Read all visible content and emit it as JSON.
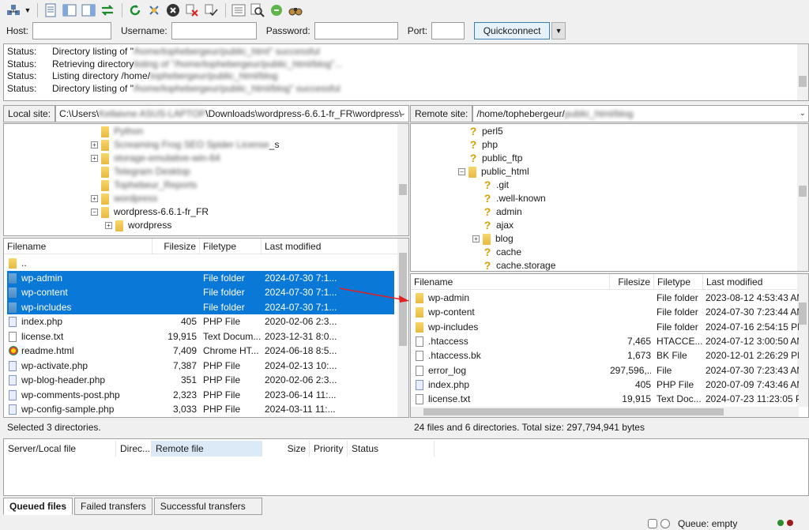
{
  "quickconnect": {
    "host_label": "Host:",
    "username_label": "Username:",
    "password_label": "Password:",
    "port_label": "Port:",
    "button_label": "Quickconnect"
  },
  "log": [
    {
      "key": "Status:",
      "text": "Directory listing of \"",
      "blurred": "/home/tophebergeur/public_html\" successful"
    },
    {
      "key": "Status:",
      "text": "Retrieving directory",
      "blurred": "listing of \"/home/tophebergeur/public_html/blog\"..."
    },
    {
      "key": "Status:",
      "text": "Listing directory /home/",
      "blurred": "tophebergeur/public_html/blog"
    },
    {
      "key": "Status:",
      "text": "Directory listing of \"",
      "blurred": "/home/tophebergeur/public_html/blog\" successful"
    }
  ],
  "local": {
    "site_label": "Local site:",
    "path_prefix": "C:\\Users\\",
    "path_blur": "Kellaivne ASUS-LAPTOP",
    "path_suffix": "\\Downloads\\wordpress-6.6.1-fr_FR\\wordpress\\",
    "tree": [
      {
        "label": "Python",
        "blurred": true,
        "expander": false,
        "indent": 0
      },
      {
        "label": "Screaming Frog SEO Spider License _s",
        "blurred_part": "Screaming Frog SEO Spider License",
        "tail": " _s",
        "expander": true,
        "indent": 0
      },
      {
        "label": "storage-emulative-win-64",
        "blurred": true,
        "expander": true,
        "indent": 0
      },
      {
        "label": "Telegram Desktop",
        "blurred": true,
        "expander": false,
        "indent": 0
      },
      {
        "label": "Tophebeur_Reports",
        "blurred": true,
        "expander": false,
        "indent": 0
      },
      {
        "label": "wordpress",
        "blurred": true,
        "expander": true,
        "indent": 0
      },
      {
        "label": "wordpress-6.6.1-fr_FR",
        "blurred": false,
        "expander": true,
        "expander_sign": "−",
        "indent": 0
      },
      {
        "label": "wordpress",
        "blurred": false,
        "expander": true,
        "indent": 1
      }
    ],
    "columns": [
      "Filename",
      "Filesize",
      "Filetype",
      "Last modified"
    ],
    "files": [
      {
        "name": "..",
        "size": "",
        "type": "",
        "modified": "",
        "icon": "folder",
        "selected": false
      },
      {
        "name": "wp-admin",
        "size": "",
        "type": "File folder",
        "modified": "2024-07-30 7:1...",
        "icon": "folder",
        "selected": true
      },
      {
        "name": "wp-content",
        "size": "",
        "type": "File folder",
        "modified": "2024-07-30 7:1...",
        "icon": "folder",
        "selected": true
      },
      {
        "name": "wp-includes",
        "size": "",
        "type": "File folder",
        "modified": "2024-07-30 7:1...",
        "icon": "folder",
        "selected": true
      },
      {
        "name": "index.php",
        "size": "405",
        "type": "PHP File",
        "modified": "2020-02-06 2:3...",
        "icon": "php",
        "selected": false
      },
      {
        "name": "license.txt",
        "size": "19,915",
        "type": "Text Docum...",
        "modified": "2023-12-31 8:0...",
        "icon": "txt",
        "selected": false
      },
      {
        "name": "readme.html",
        "size": "7,409",
        "type": "Chrome HT...",
        "modified": "2024-06-18 8:5...",
        "icon": "html",
        "selected": false
      },
      {
        "name": "wp-activate.php",
        "size": "7,387",
        "type": "PHP File",
        "modified": "2024-02-13 10:...",
        "icon": "php",
        "selected": false
      },
      {
        "name": "wp-blog-header.php",
        "size": "351",
        "type": "PHP File",
        "modified": "2020-02-06 2:3...",
        "icon": "php",
        "selected": false
      },
      {
        "name": "wp-comments-post.php",
        "size": "2,323",
        "type": "PHP File",
        "modified": "2023-06-14 11:...",
        "icon": "php",
        "selected": false
      },
      {
        "name": "wp-config-sample.php",
        "size": "3,033",
        "type": "PHP File",
        "modified": "2024-03-11 11:...",
        "icon": "php",
        "selected": false
      }
    ],
    "status": "Selected 3 directories."
  },
  "remote": {
    "site_label": "Remote site:",
    "path_prefix": "/home/tophebergeur/",
    "path_blur": "public_html/blog",
    "tree": [
      {
        "label": "perl5",
        "icon": "q",
        "indent": 0,
        "expander": false
      },
      {
        "label": "php",
        "icon": "q",
        "indent": 0,
        "expander": false
      },
      {
        "label": "public_ftp",
        "icon": "q",
        "indent": 0,
        "expander": false
      },
      {
        "label": "public_html",
        "icon": "folder",
        "indent": 0,
        "expander": true,
        "expander_sign": "−"
      },
      {
        "label": ".git",
        "icon": "q",
        "indent": 1,
        "expander": false
      },
      {
        "label": ".well-known",
        "icon": "q",
        "indent": 1,
        "expander": false
      },
      {
        "label": "admin",
        "icon": "q",
        "indent": 1,
        "expander": false
      },
      {
        "label": "ajax",
        "icon": "q",
        "indent": 1,
        "expander": false
      },
      {
        "label": "blog",
        "icon": "folder",
        "indent": 1,
        "expander": true
      },
      {
        "label": "cache",
        "icon": "q",
        "indent": 1,
        "expander": false
      },
      {
        "label": "cache.storage",
        "icon": "q",
        "indent": 1,
        "expander": false
      }
    ],
    "columns": [
      "Filename",
      "Filesize",
      "Filetype",
      "Last modified"
    ],
    "files": [
      {
        "name": "wp-admin",
        "size": "",
        "type": "File folder",
        "modified": "2023-08-12 4:53:43 AM",
        "icon": "folder"
      },
      {
        "name": "wp-content",
        "size": "",
        "type": "File folder",
        "modified": "2024-07-30 7:23:44 AM",
        "icon": "folder"
      },
      {
        "name": "wp-includes",
        "size": "",
        "type": "File folder",
        "modified": "2024-07-16 2:54:15 PM",
        "icon": "folder"
      },
      {
        "name": ".htaccess",
        "size": "7,465",
        "type": "HTACCE...",
        "modified": "2024-07-12 3:00:50 AM",
        "icon": "txt"
      },
      {
        "name": ".htaccess.bk",
        "size": "1,673",
        "type": "BK File",
        "modified": "2020-12-01 2:26:29 PM",
        "icon": "txt"
      },
      {
        "name": "error_log",
        "size": "297,596,...",
        "type": "File",
        "modified": "2024-07-30 7:23:43 AM",
        "icon": "txt"
      },
      {
        "name": "index.php",
        "size": "405",
        "type": "PHP File",
        "modified": "2020-07-09 7:43:46 AM",
        "icon": "php"
      },
      {
        "name": "license.txt",
        "size": "19,915",
        "type": "Text Doc...",
        "modified": "2024-07-23 11:23:05 PM",
        "icon": "txt"
      }
    ],
    "status": "24 files and 6 directories. Total size: 297,794,941 bytes"
  },
  "queue": {
    "columns": [
      "Server/Local file",
      "Direc...",
      "Remote file",
      "Size",
      "Priority",
      "Status"
    ]
  },
  "tabs": [
    "Queued files",
    "Failed transfers",
    "Successful transfers"
  ],
  "footer": {
    "queue_text": "Queue: empty"
  },
  "colors": {
    "selection": "#0a78d7",
    "arrow": "#e02020"
  }
}
